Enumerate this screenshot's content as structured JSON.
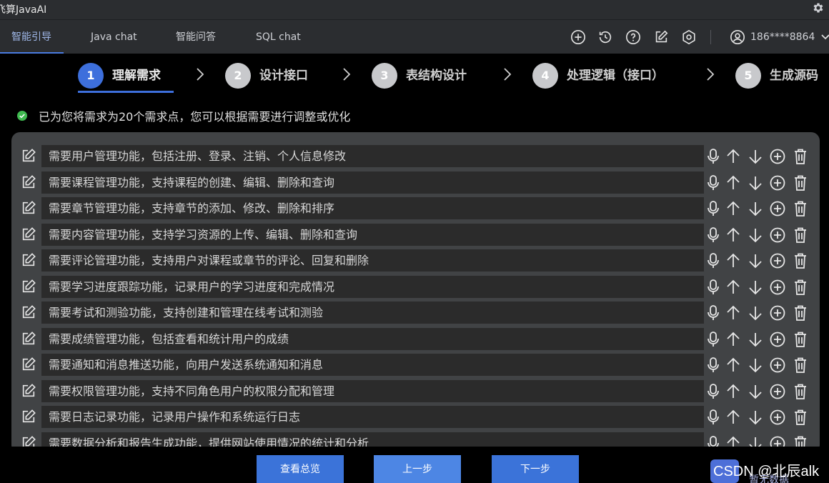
{
  "app": {
    "title": "飞算JavaAI"
  },
  "nav": {
    "tabs": [
      {
        "label": "智能引导"
      },
      {
        "label": "Java chat"
      },
      {
        "label": "智能问答"
      },
      {
        "label": "SQL chat"
      }
    ],
    "user": "186****8864"
  },
  "steps": [
    {
      "num": "1",
      "label": "理解需求"
    },
    {
      "num": "2",
      "label": "设计接口"
    },
    {
      "num": "3",
      "label": "表结构设计"
    },
    {
      "num": "4",
      "label": "处理逻辑（接口）"
    },
    {
      "num": "5",
      "label": "生成源码"
    }
  ],
  "notice": "已为您将需求为20个需求点，您可以根据需要进行调整或优化",
  "requirements": [
    "需要用户管理功能，包括注册、登录、注销、个人信息修改",
    "需要课程管理功能，支持课程的创建、编辑、删除和查询",
    "需要章节管理功能，支持章节的添加、修改、删除和排序",
    "需要内容管理功能，支持学习资源的上传、编辑、删除和查询",
    "需要评论管理功能，支持用户对课程或章节的评论、回复和删除",
    "需要学习进度跟踪功能，记录用户的学习进度和完成情况",
    "需要考试和测验功能，支持创建和管理在线考试和测验",
    "需要成绩管理功能，包括查看和统计用户的成绩",
    "需要通知和消息推送功能，向用户发送系统通知和消息",
    "需要权限管理功能，支持不同角色用户的权限分配和管理",
    "需要日志记录功能，记录用户操作和系统运行日志",
    "需要数据分析和报告生成功能，提供网站使用情况的统计和分析"
  ],
  "buttons": {
    "overview": "查看总览",
    "prev": "上一步",
    "next": "下一步"
  },
  "watermark": {
    "text": "CSDN @北辰alk",
    "sub": "暂无数据"
  },
  "colors": {
    "accent": "#3d6fdc",
    "success": "#3fb950",
    "panel": "#414345",
    "field": "#2b2b2b"
  }
}
